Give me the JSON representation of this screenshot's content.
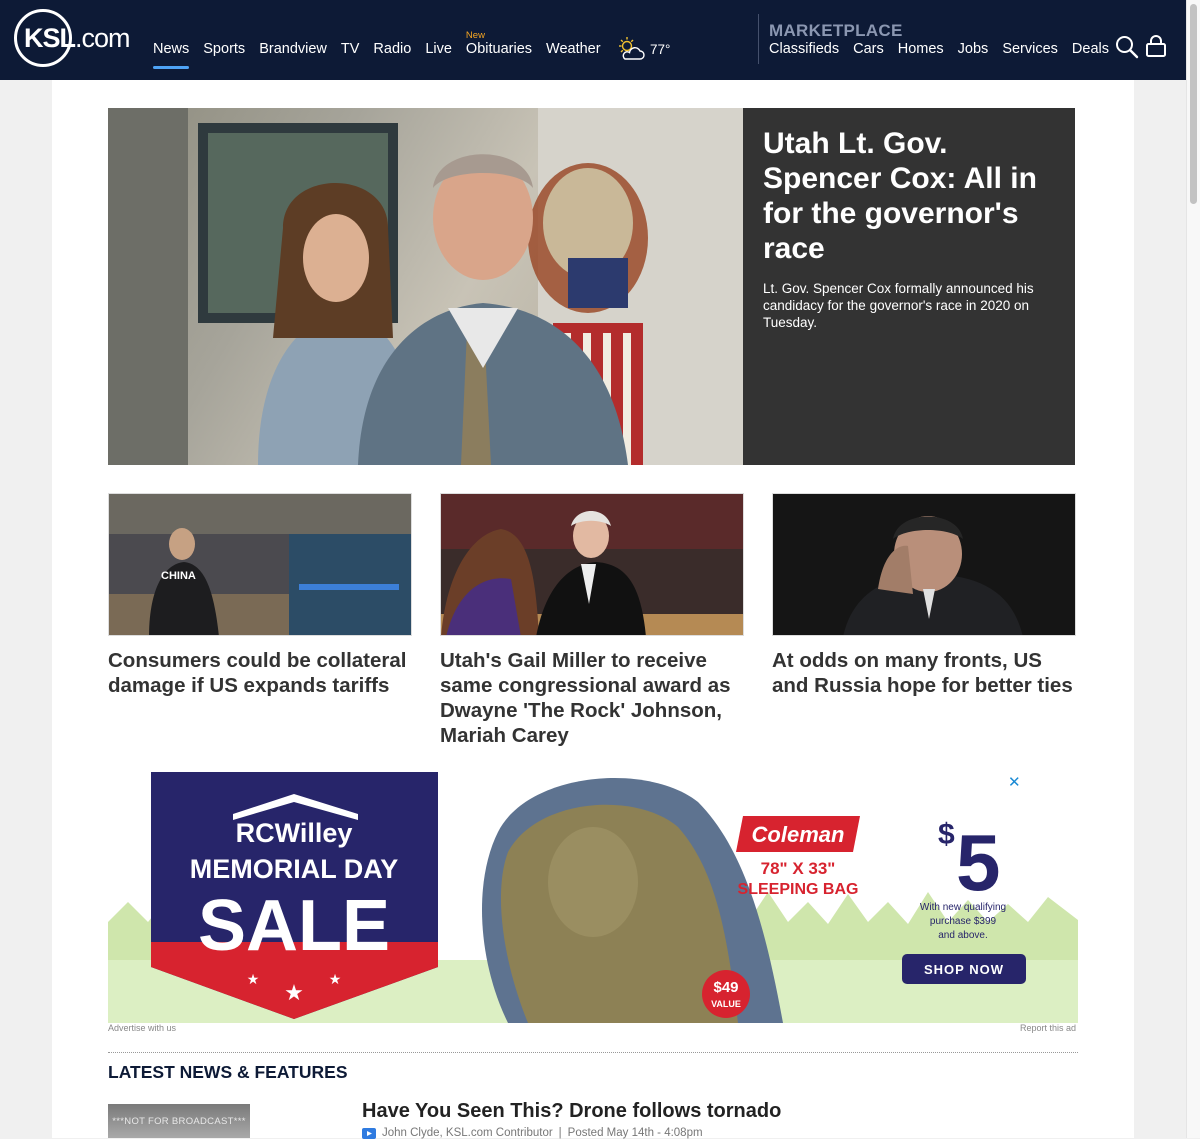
{
  "header": {
    "logo_text": "KSL",
    "logo_suffix": ".com",
    "nav": [
      {
        "label": "News",
        "active": true
      },
      {
        "label": "Sports"
      },
      {
        "label": "Brandview"
      },
      {
        "label": "TV"
      },
      {
        "label": "Radio"
      },
      {
        "label": "Live"
      },
      {
        "label": "Obituaries",
        "badge": "New"
      },
      {
        "label": "Weather"
      }
    ],
    "weather_temp": "77°",
    "weather_icon": "partly-cloudy-sun-icon",
    "marketplace_title": "MARKETPLACE",
    "marketplace_nav": [
      "Classifieds",
      "Cars",
      "Homes",
      "Jobs",
      "Services",
      "Deals"
    ],
    "search_icon": "search-icon",
    "account_icon": "account-lock-icon"
  },
  "hero": {
    "title": "Utah Lt. Gov. Spencer Cox: All in for the governor's race",
    "summary": "Lt. Gov. Spencer Cox formally announced his candidacy for the governor's race in 2020 on Tuesday."
  },
  "cards": [
    {
      "title": "Consumers could be collateral damage if US expands tariffs",
      "thumb_text": "CHINA"
    },
    {
      "title": "Utah's Gail Miller to receive same congressional award as Dwayne 'The Rock' Johnson, Mariah Carey"
    },
    {
      "title": "At odds on many fronts, US and Russia hope for better ties"
    }
  ],
  "ad": {
    "brand": "RCWilley",
    "headline_top": "MEMORIAL DAY",
    "headline_big": "SALE",
    "product_brand": "Coleman",
    "product_line1": "78\" X 33\"",
    "product_line2": "SLEEPING BAG",
    "price_symbol": "$",
    "price": "5",
    "price_note_1": "With new qualifying",
    "price_note_2": "purchase $399",
    "price_note_3": "and above.",
    "cta": "SHOP NOW",
    "value_price": "$49",
    "value_label": "VALUE",
    "close_label": "✕",
    "advertise_link": "Advertise with us",
    "report_link": "Report this ad"
  },
  "latest": {
    "section_title": "LATEST NEWS & FEATURES",
    "item_title": "Have You Seen This? Drone follows tornado",
    "thumb_text": "***NOT FOR BROADCAST***",
    "author": "John Clyde, KSL.com Contributor",
    "separator": "|",
    "posted": "Posted May 14th - 4:08pm"
  },
  "colors": {
    "header_bg": "#0d1a36",
    "active_underline": "#4ea3f5",
    "badge_new": "#f5a623",
    "hero_panel": "#333333",
    "ad_navy": "#27256a",
    "ad_red": "#d7232f",
    "ad_green": "#d8edb9"
  }
}
